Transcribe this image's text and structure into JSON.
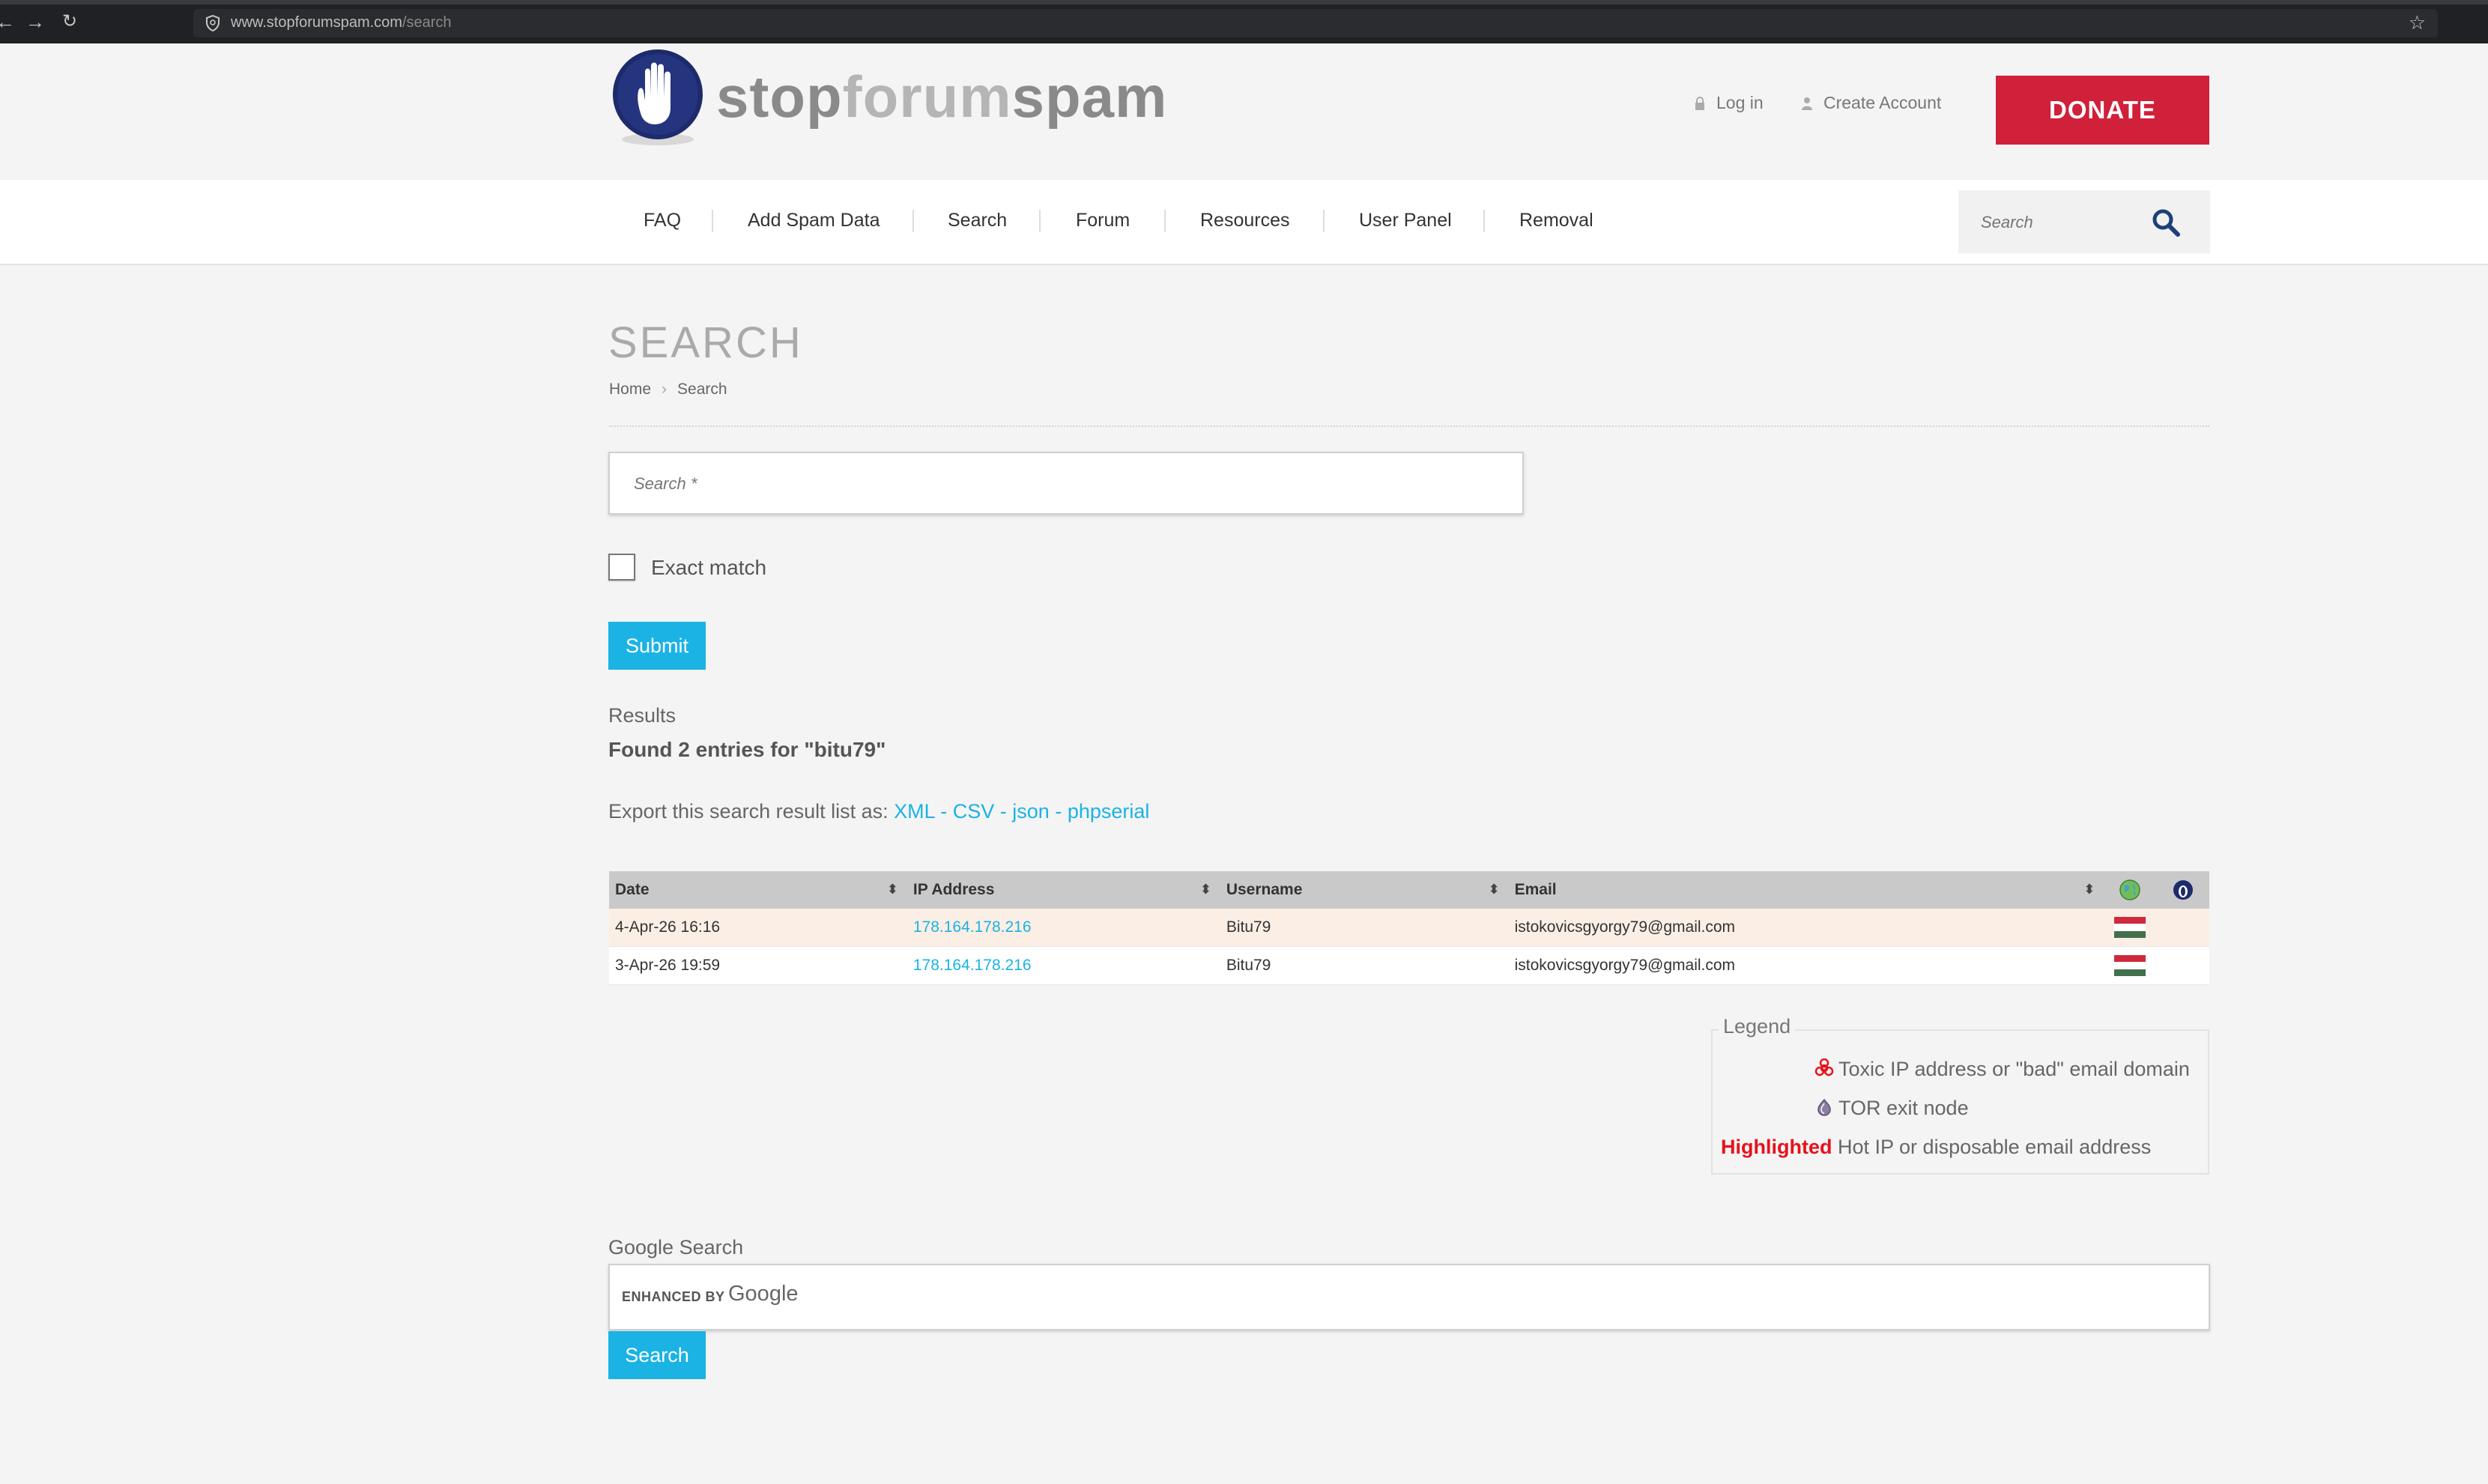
{
  "browser": {
    "url_host": "www.stopforumspam.com",
    "url_path": "/search",
    "back_icon": "arrow-left-icon",
    "forward_icon": "arrow-right-icon",
    "reload_icon": "reload-icon",
    "bookmark_icon": "star-icon"
  },
  "header": {
    "logo_part1": "stop",
    "logo_part2": "forum",
    "logo_part3": "spam",
    "login_label": "Log in",
    "create_account_label": "Create Account",
    "donate_label": "DONATE",
    "donate_color": "#d0203a"
  },
  "nav": {
    "items": [
      "FAQ",
      "Add Spam Data",
      "Search",
      "Forum",
      "Resources",
      "User Panel",
      "Removal"
    ],
    "search_placeholder": "Search"
  },
  "main": {
    "title": "SEARCH",
    "breadcrumb": [
      "Home",
      "Search"
    ],
    "search_placeholder": "Search *",
    "exact_match_label": "Exact match",
    "submit_label": "Submit",
    "results_label": "Results",
    "found_text": "Found 2 entries for \"bitu79\"",
    "export_prefix": "Export this search result list as:",
    "export_links": [
      "XML",
      "CSV",
      "json",
      "phpserial"
    ],
    "accent_color": "#1ab3e4"
  },
  "table": {
    "headers": [
      "Date",
      "IP Address",
      "Username",
      "Email"
    ],
    "rows": [
      {
        "date": "4-Apr-26 16:16",
        "ip": "178.164.178.216",
        "username": "Bitu79",
        "email": "istokovicsgyorgy79@gmail.com",
        "flag": "hungary"
      },
      {
        "date": "3-Apr-26 19:59",
        "ip": "178.164.178.216",
        "username": "Bitu79",
        "email": "istokovicsgyorgy79@gmail.com",
        "flag": "hungary"
      }
    ]
  },
  "legend": {
    "title": "Legend",
    "toxic": "Toxic IP address or \"bad\" email domain",
    "tor": "TOR exit node",
    "highlighted_word": "Highlighted",
    "highlighted_desc": "Hot IP or disposable email address"
  },
  "google": {
    "label": "Google Search",
    "enhanced_by": "ENHANCED BY",
    "google_word": "Google",
    "search_button": "Search"
  }
}
